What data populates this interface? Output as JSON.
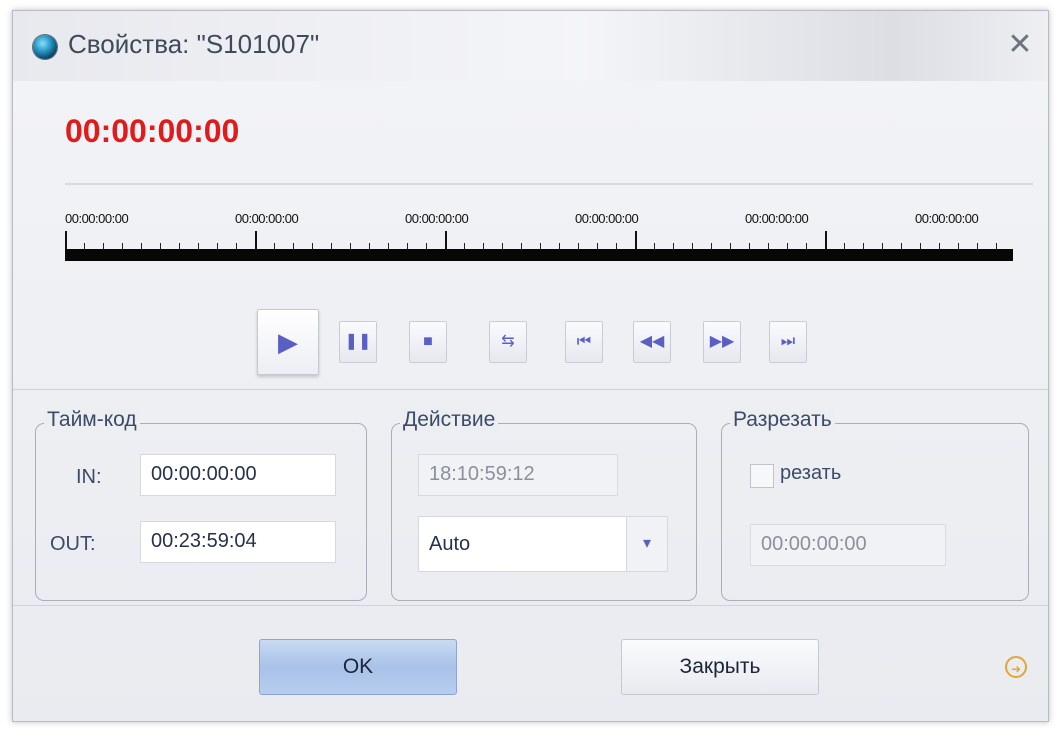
{
  "window": {
    "title": "Свойства: \"S101007\"",
    "close_icon": "close-icon",
    "app_icon": "globe-icon"
  },
  "current_timecode": "00:00:00:00",
  "timeline": {
    "tick_labels": [
      "00:00:00:00",
      "00:00:00:00",
      "00:00:00:00",
      "00:00:00:00",
      "00:00:00:00",
      "00:00:00:00"
    ]
  },
  "transport": {
    "play": "▶",
    "pause": "❚❚",
    "stop": "■",
    "toggle": "⇆",
    "first": "⏮",
    "rewind": "◀◀",
    "forward": "▶▶",
    "last": "⏭"
  },
  "timecode_group": {
    "label": "Тайм-код",
    "in_label": "IN:",
    "in_value": "00:00:00:00",
    "out_label": "OUT:",
    "out_value": "00:23:59:04"
  },
  "action_group": {
    "label": "Действие",
    "time_value": "18:10:59:12",
    "select_value": "Auto"
  },
  "cut_group": {
    "label": "Разрезать",
    "checkbox_label": "резать",
    "checked": false,
    "time_value": "00:00:00:00"
  },
  "buttons": {
    "ok": "OK",
    "close": "Закрыть"
  },
  "colors": {
    "timecode": "#e01b1b",
    "accent": "#5a5fc6"
  }
}
